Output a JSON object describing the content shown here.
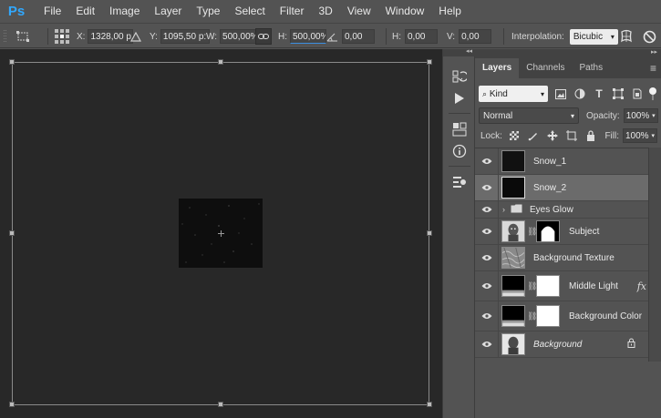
{
  "app": {
    "logo": "Ps"
  },
  "menu": [
    "File",
    "Edit",
    "Image",
    "Layer",
    "Type",
    "Select",
    "Filter",
    "3D",
    "View",
    "Window",
    "Help"
  ],
  "options": {
    "x_label": "X:",
    "x_value": "1328,00 p:",
    "y_label": "Y:",
    "y_value": "1095,50 p:",
    "w_label": "W:",
    "w_value": "500,00%",
    "h_label": "H:",
    "h_value": "500,00%",
    "rotate_value": "0,00",
    "hskew_label": "H:",
    "hskew_value": "0,00",
    "vskew_label": "V:",
    "vskew_value": "0,00",
    "interp_label": "Interpolation:",
    "interp_value": "Bicubic"
  },
  "layers_panel": {
    "tabs": [
      "Layers",
      "Channels",
      "Paths"
    ],
    "kind_value": "Kind",
    "blend_value": "Normal",
    "opacity_label": "Opacity:",
    "opacity_value": "100%",
    "lock_label": "Lock:",
    "fill_label": "Fill:",
    "fill_value": "100%",
    "layers": [
      {
        "name": "Snow_1"
      },
      {
        "name": "Snow_2"
      },
      {
        "name": "Eyes Glow"
      },
      {
        "name": "Subject"
      },
      {
        "name": "Background Texture"
      },
      {
        "name": "Middle Light",
        "fx": "fx"
      },
      {
        "name": "Background Color"
      },
      {
        "name": "Background"
      }
    ]
  },
  "colors": {
    "accent": "#31a8ff",
    "canvas": "#282828",
    "panel": "#535353"
  }
}
